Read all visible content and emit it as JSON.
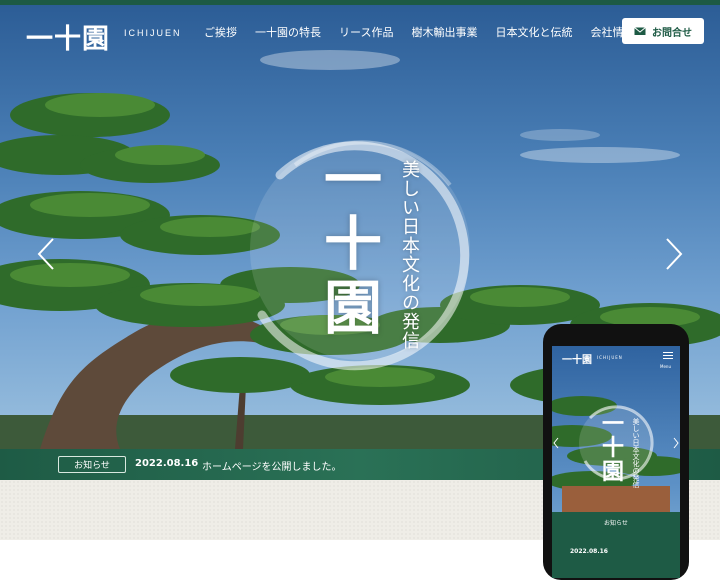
{
  "header": {
    "logo_kanji": "一十園",
    "logo_roman": "ICHIJUEN",
    "nav": [
      {
        "label": "ご挨拶"
      },
      {
        "label": "一十園の特長"
      },
      {
        "label": "リース作品"
      },
      {
        "label": "樹木輸出事業"
      },
      {
        "label": "日本文化と伝統"
      },
      {
        "label": "会社情報"
      }
    ],
    "contact_label": "お問合せ"
  },
  "hero": {
    "title": "一\n十\n園",
    "tagline": "美しい日本文化の発信"
  },
  "news": {
    "badge": "お知らせ",
    "date": "2022.08.16",
    "text": "ホームページを公開しました。"
  },
  "phone": {
    "logo_kanji": "一十園",
    "logo_roman": "ICHIJUEN",
    "menu_label": "Menu",
    "title": "一\n十\n園",
    "tagline": "美しい日本文化の発信",
    "news_label": "お知らせ",
    "news_date": "2022.08.16"
  },
  "colors": {
    "brand_green": "#1d5a44",
    "sky_blue": "#4a7fb6"
  }
}
